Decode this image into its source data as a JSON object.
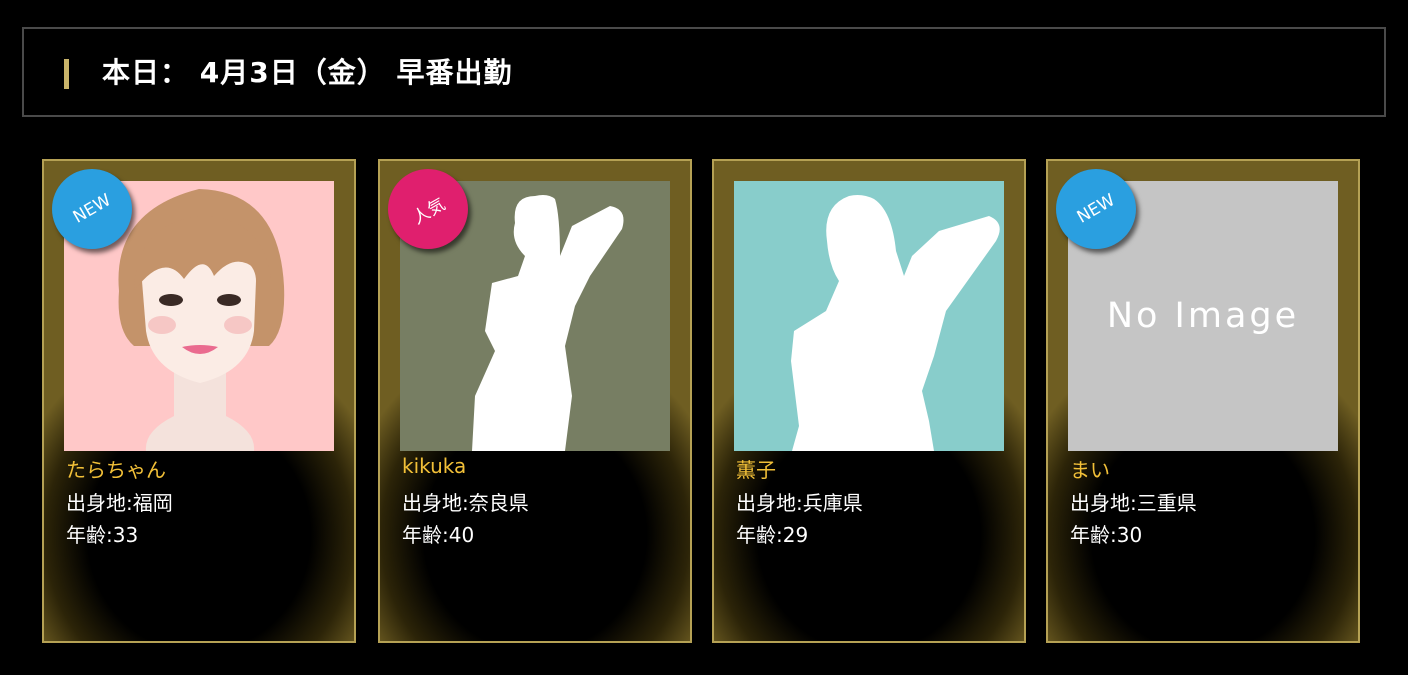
{
  "header": {
    "title": "本日： 4月3日（金） 早番出勤"
  },
  "colors": {
    "accent_gold": "#c9b46a",
    "name_color": "#f2c038",
    "new_badge": "#2a9fe0",
    "popular_badge": "#e01f6e"
  },
  "cards": [
    {
      "name": "たらちゃん",
      "origin": "出身地:福岡",
      "age": "年齢:33",
      "badge": "NEW"
    },
    {
      "name": "kikuka",
      "origin": "出身地:奈良県",
      "age": "年齢:40",
      "badge": "人気"
    },
    {
      "name": "薫子",
      "origin": "出身地:兵庫県",
      "age": "年齢:29",
      "badge": ""
    },
    {
      "name": "まい",
      "origin": "出身地:三重県",
      "age": "年齢:30",
      "badge": "NEW",
      "no_image": "No Image"
    }
  ]
}
